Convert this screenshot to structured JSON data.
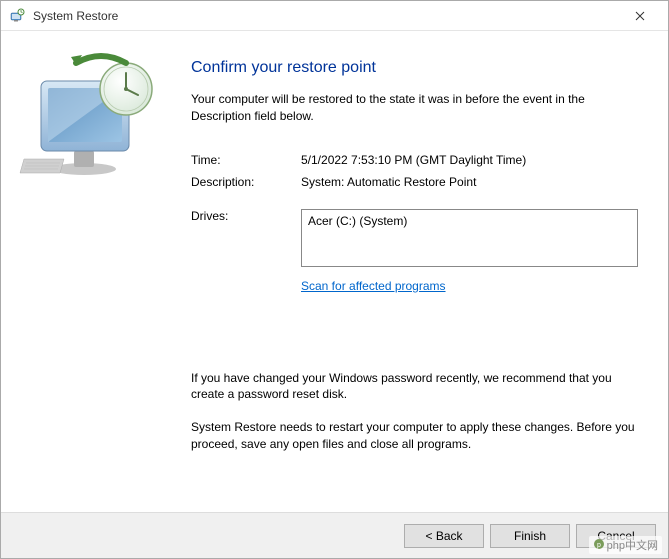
{
  "window": {
    "title": "System Restore"
  },
  "main": {
    "heading": "Confirm your restore point",
    "subtext": "Your computer will be restored to the state it was in before the event in the Description field below.",
    "timeLabel": "Time:",
    "timeValue": "5/1/2022 7:53:10 PM (GMT Daylight Time)",
    "descLabel": "Description:",
    "descValue": "System: Automatic Restore Point",
    "drivesLabel": "Drives:",
    "drivesValue": "Acer (C:) (System)",
    "scanLink": "Scan for affected programs",
    "note1": "If you have changed your Windows password recently, we recommend that you create a password reset disk.",
    "note2": "System Restore needs to restart your computer to apply these changes. Before you proceed, save any open files and close all programs."
  },
  "footer": {
    "back": "< Back",
    "finish": "Finish",
    "cancel": "Cancel"
  },
  "watermark": {
    "text": "php中文网"
  }
}
